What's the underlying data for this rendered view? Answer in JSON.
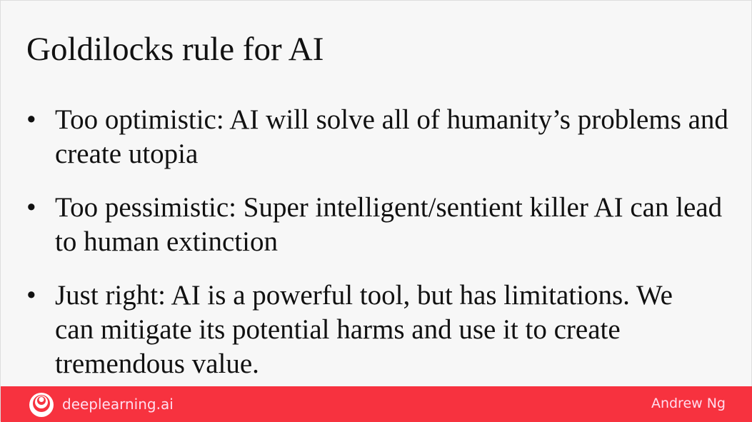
{
  "slide": {
    "title": "Goldilocks rule for AI",
    "bullets": [
      {
        "text": "Too optimistic: AI will solve all of humanity’s problems and create utopia"
      },
      {
        "text": "Too pessimistic: Super intelligent/sentient killer AI can lead to human extinction"
      },
      {
        "text": "Just right: AI is a powerful tool, but has limitations. We can mitigate its potential harms and use it to create tremendous value."
      }
    ],
    "bullet_glyph": "•"
  },
  "footer": {
    "brand": "deeplearning.ai",
    "author": "Andrew Ng",
    "logo_icon": "deeplearning-logo-icon",
    "color": "#f7323f"
  }
}
